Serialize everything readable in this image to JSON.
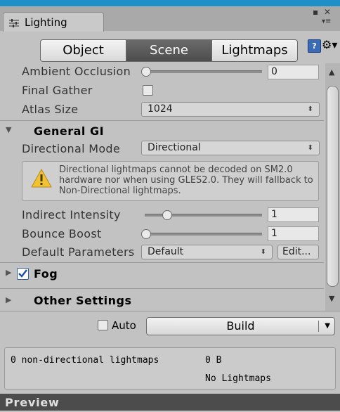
{
  "window": {
    "tab_title": "Lighting",
    "max_glyph": "▪",
    "close_glyph": "✕",
    "menu_glyph": "▾≡"
  },
  "modes": {
    "object": "Object",
    "scene": "Scene",
    "lightmaps": "Lightmaps"
  },
  "toolbar": {
    "help_glyph": "?",
    "gear_glyph": "⚙▾"
  },
  "settings": {
    "ambient_occlusion": {
      "label": "Ambient Occlusion",
      "value": "0",
      "level": 0
    },
    "final_gather": {
      "label": "Final Gather",
      "checked": false
    },
    "atlas_size": {
      "label": "Atlas Size",
      "value": "1024"
    }
  },
  "general_gi": {
    "title": "General GI",
    "directional_mode": {
      "label": "Directional Mode",
      "value": "Directional"
    },
    "warning": "Directional lightmaps cannot be decoded on SM2.0 hardware nor when using GLES2.0. They will fallback to Non-Directional lightmaps.",
    "indirect_intensity": {
      "label": "Indirect Intensity",
      "value": "1",
      "level": 0.2
    },
    "bounce_boost": {
      "label": "Bounce Boost",
      "value": "1",
      "level": 0
    },
    "default_parameters": {
      "label": "Default Parameters",
      "value": "Default",
      "edit": "Edit..."
    }
  },
  "fog": {
    "title": "Fog",
    "checked": true
  },
  "other_settings": {
    "title": "Other Settings"
  },
  "build": {
    "auto_label": "Auto",
    "auto_checked": false,
    "button": "Build"
  },
  "stats": {
    "nondirectional": "0 non-directional lightmaps",
    "size": "0 B",
    "lightmaps": "No Lightmaps"
  },
  "preview": {
    "title": "Preview"
  },
  "colors": {
    "accent": "#1e8fc7",
    "panel": "#c2c2c2",
    "warning": "#f1c232"
  }
}
